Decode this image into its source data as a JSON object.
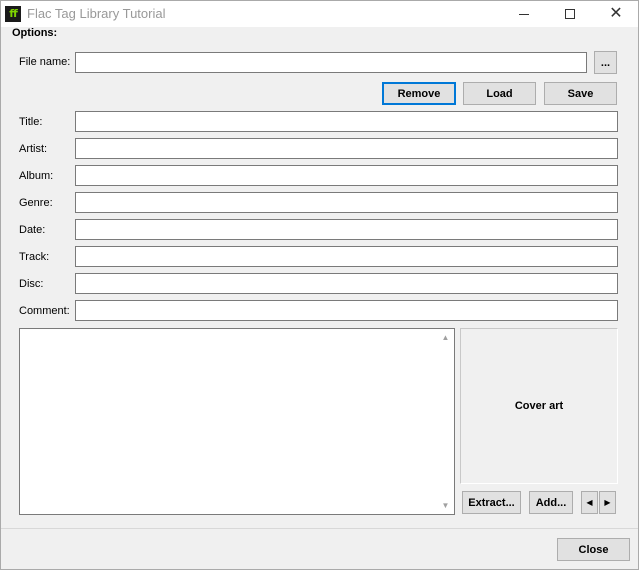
{
  "window": {
    "title": "Flac Tag Library Tutorial",
    "icon": "flac-app-icon",
    "controls": {
      "minimize": "minimize-icon",
      "maximize": "maximize-icon",
      "close": "close-icon"
    }
  },
  "options_label": "Options:",
  "file": {
    "label": "File name:",
    "value": "",
    "browse_label": "..."
  },
  "actions": {
    "remove_label": "Remove",
    "load_label": "Load",
    "save_label": "Save"
  },
  "fields": [
    {
      "label": "Title:",
      "value": ""
    },
    {
      "label": "Artist:",
      "value": ""
    },
    {
      "label": "Album:",
      "value": ""
    },
    {
      "label": "Genre:",
      "value": ""
    },
    {
      "label": "Date:",
      "value": ""
    },
    {
      "label": "Track:",
      "value": ""
    },
    {
      "label": "Disc:",
      "value": ""
    },
    {
      "label": "Comment:",
      "value": ""
    }
  ],
  "cover": {
    "label": "Cover art",
    "extract_label": "Extract...",
    "add_label": "Add...",
    "prev_icon": "left-arrow-icon",
    "next_icon": "right-arrow-icon"
  },
  "close_label": "Close"
}
